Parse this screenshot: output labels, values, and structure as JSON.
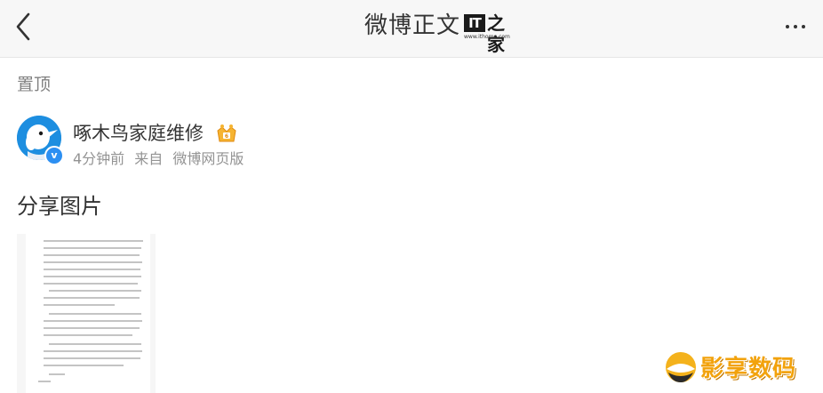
{
  "navbar": {
    "title": "微博正文",
    "logo_mark": "IT",
    "logo_text": "之家",
    "logo_url": "www.ithome.com",
    "back_icon": "chevron-left-icon",
    "more_icon": "more-dots-icon"
  },
  "pinned_label": "置顶",
  "post": {
    "author": "啄木鸟家庭维修",
    "verified_mark": "v",
    "time": "4分钟前",
    "source_prefix": "来自",
    "source": "微博网页版",
    "text": "分享图片",
    "image_icon": "document-screenshot"
  },
  "watermark": {
    "text": "影享数码"
  },
  "colors": {
    "navbar_bg": "#f7f7f7",
    "avatar_blue": "#1d8ee0",
    "meta_gray": "#939393",
    "watermark_orange": "#f2a20c"
  }
}
